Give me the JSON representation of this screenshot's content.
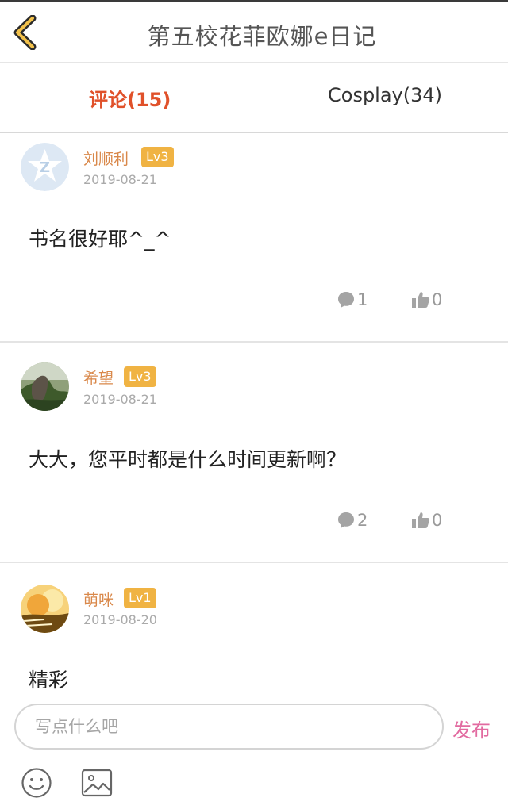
{
  "header": {
    "title": "第五校花菲欧娜e日记"
  },
  "tabs": [
    {
      "label": "评论(15)",
      "active": true
    },
    {
      "label": "Cosplay(34)",
      "active": false
    }
  ],
  "comments": [
    {
      "user": "刘顺利",
      "level": "Lv3",
      "date": "2019-08-21",
      "text": "书名很好耶^_^",
      "replies": "1",
      "likes": "0",
      "avatar": "default-avatar-icon"
    },
    {
      "user": "希望",
      "level": "Lv3",
      "date": "2019-08-21",
      "text": "大大，您平时都是什么时间更新啊？",
      "replies": "2",
      "likes": "0",
      "avatar": "landscape-photo"
    },
    {
      "user": "萌咪",
      "level": "Lv1",
      "date": "2019-08-20",
      "text": "精彩",
      "avatar": "sunset-photo"
    }
  ],
  "composer": {
    "placeholder": "写点什么吧",
    "publish_label": "发布"
  },
  "colors": {
    "accent_tab": "#e0512a",
    "username": "#d9884a",
    "level_badge": "#f0b343",
    "publish": "#e26aa0"
  }
}
